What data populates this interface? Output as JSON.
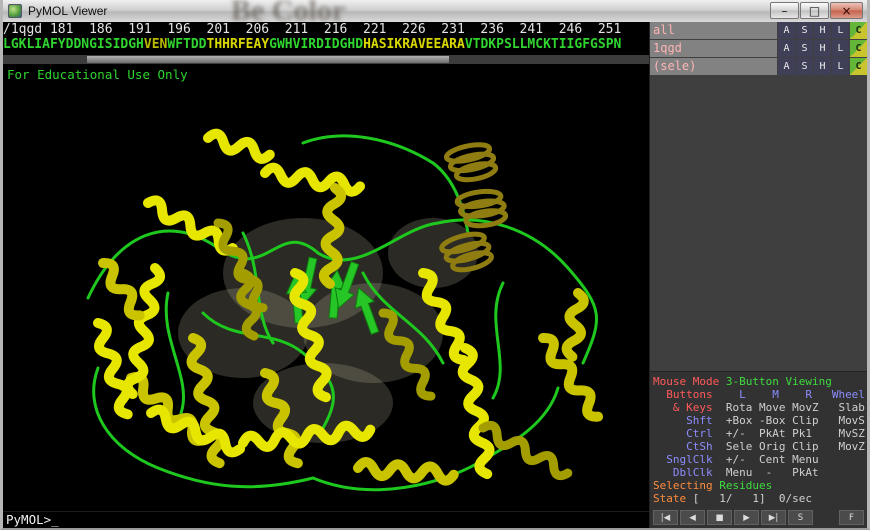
{
  "window": {
    "title": "PyMOL Viewer",
    "background_text": "Be Color",
    "controls": {
      "minimize": "–",
      "maximize": "□",
      "close": "×"
    }
  },
  "sequence": {
    "ruler": "/1qgd 181  186  191  196  201  206  211  216  221  226  231  236  241  246  251",
    "segments": [
      {
        "text": "LGKLIAFYDDNGISIDGH",
        "color": "#2fd42f"
      },
      {
        "text": "VEN",
        "color": "#b9b900"
      },
      {
        "text": "WFTDD",
        "color": "#2fd42f"
      },
      {
        "text": "THHRFEAY",
        "color": "#d8d800"
      },
      {
        "text": "GWHVIRDIDGHD",
        "color": "#2fd42f"
      },
      {
        "text": "HASIKRAVEEARA",
        "color": "#d8d800"
      },
      {
        "text": "VTDKPSLLMCKTIIGFGSPN",
        "color": "#2fd42f"
      }
    ]
  },
  "watermark": "For Educational Use Only",
  "object_panel": {
    "buttons": [
      "A",
      "S",
      "H",
      "L",
      "C"
    ],
    "rows": [
      {
        "name": "all"
      },
      {
        "name": "1qgd"
      },
      {
        "name": "(sele)"
      }
    ]
  },
  "mouse_panel": {
    "colors": {
      "r": "#ff5a5a",
      "g": "#3ddc3d",
      "b": "#8c8cff",
      "w": "#d0d0d0",
      "o": "#ff8c3c"
    },
    "rows": [
      [
        [
          "Mouse Mode ",
          "r"
        ],
        [
          "3-Button Viewing",
          "g"
        ]
      ],
      [
        [
          "  Buttons ",
          "r"
        ],
        [
          "   L    M    R   Wheel",
          "b"
        ]
      ],
      [
        [
          "   & Keys ",
          "r"
        ],
        [
          " Rota Move MovZ   Slab",
          "w"
        ]
      ],
      [
        [
          "     Shft ",
          "b"
        ],
        [
          " +Box -Box Clip   MovS",
          "w"
        ]
      ],
      [
        [
          "     Ctrl ",
          "b"
        ],
        [
          " +/-  PkAt Pk1    MvSZ",
          "w"
        ]
      ],
      [
        [
          "     CtSh ",
          "b"
        ],
        [
          " Sele Orig Clip   MovZ",
          "w"
        ]
      ],
      [
        [
          "  SnglClk ",
          "b"
        ],
        [
          " +/-  Cent Menu",
          "w"
        ]
      ],
      [
        [
          "   DblClk ",
          "b"
        ],
        [
          " Menu  -   PkAt",
          "w"
        ]
      ],
      [
        [
          "Selecting ",
          "o"
        ],
        [
          "Residues",
          "g"
        ]
      ],
      [
        [
          "State ",
          "o"
        ],
        [
          "[   1/   1]  0/sec",
          "w"
        ]
      ]
    ]
  },
  "vcr": {
    "buttons": [
      "|◀",
      "◀",
      "■",
      "▶",
      "▶|",
      "S",
      "F"
    ],
    "names": [
      "rewind",
      "back",
      "stop",
      "play",
      "end",
      "scene",
      "fullscreen"
    ]
  },
  "command_line": {
    "prompt": "PyMOL>",
    "cursor": "_"
  }
}
